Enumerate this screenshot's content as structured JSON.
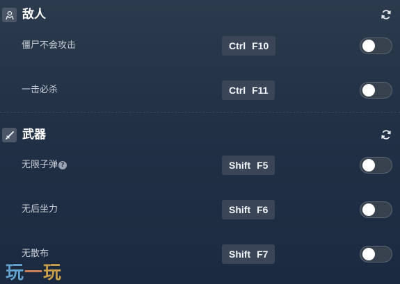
{
  "sections": [
    {
      "title": "敌人",
      "icon": "person-icon",
      "rows": [
        {
          "label": "僵尸不会攻击",
          "keys": [
            "Ctrl",
            "F10"
          ],
          "enabled": false
        },
        {
          "label": "一击必杀",
          "keys": [
            "Ctrl",
            "F11"
          ],
          "enabled": false
        }
      ]
    },
    {
      "title": "武器",
      "icon": "sword-icon",
      "rows": [
        {
          "label": "无限子弹",
          "keys": [
            "Shift",
            "F5"
          ],
          "enabled": false,
          "help": "?"
        },
        {
          "label": "无后坐力",
          "keys": [
            "Shift",
            "F6"
          ],
          "enabled": false
        },
        {
          "label": "无散布",
          "keys": [
            "Shift",
            "F7"
          ],
          "enabled": false
        }
      ]
    }
  ],
  "watermark": {
    "c1": "玩",
    "c2": "一",
    "c3": "玩"
  },
  "colors": {
    "hotkey_bg": "#3a4657",
    "toggle_off": "#38414e",
    "accent_icon_bg": "#4b5768"
  }
}
